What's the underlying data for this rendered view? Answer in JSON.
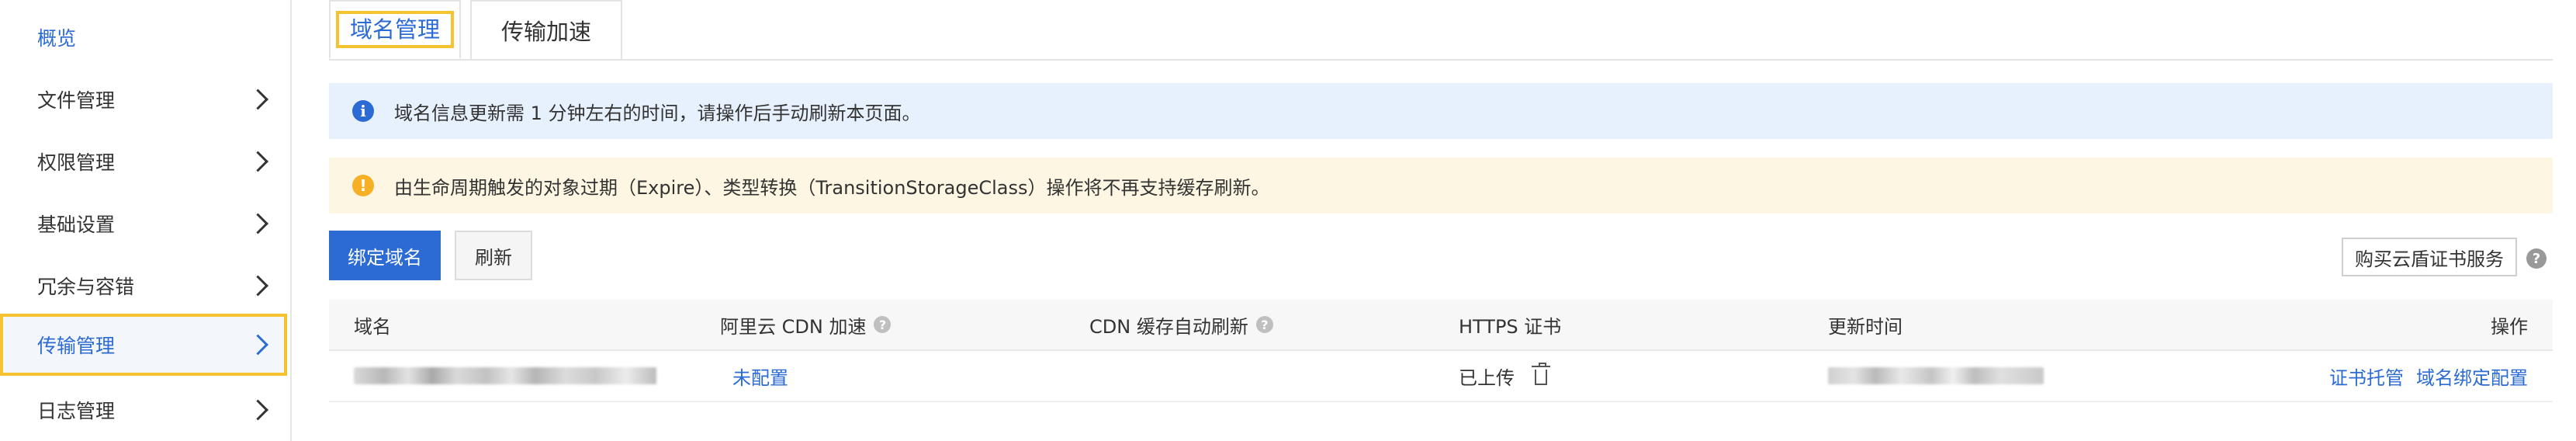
{
  "sidebar": {
    "items": [
      {
        "label": "概览"
      },
      {
        "label": "文件管理"
      },
      {
        "label": "权限管理"
      },
      {
        "label": "基础设置"
      },
      {
        "label": "冗余与容错"
      },
      {
        "label": "传输管理"
      },
      {
        "label": "日志管理"
      }
    ],
    "active": "传输管理"
  },
  "tabs": [
    {
      "label": "域名管理",
      "selected": true
    },
    {
      "label": "传输加速",
      "selected": false
    }
  ],
  "banners": {
    "info": {
      "text": "域名信息更新需 1 分钟左右的时间，请操作后手动刷新本页面。",
      "icon": "info-icon"
    },
    "warning": {
      "text": "由生命周期触发的对象过期（Expire）、类型转换（TransitionStorageClass）操作将不再支持缓存刷新。",
      "icon": "warning-icon"
    }
  },
  "toolbar": {
    "bind_domain": "绑定域名",
    "refresh": "刷新",
    "buy_cert": "购买云盾证书服务"
  },
  "table": {
    "columns": [
      "域名",
      "阿里云 CDN 加速",
      "CDN 缓存自动刷新",
      "HTTPS 证书",
      "更新时间",
      "操作"
    ],
    "rows": [
      {
        "cdn": "未配置",
        "https": "已上传",
        "actions": [
          "证书托管",
          "域名绑定配置"
        ]
      }
    ]
  },
  "colors": {
    "accent": "#2c6bd4",
    "highlight": "#f4c430",
    "info_bg": "#e7f1fd",
    "warn_bg": "#fdf6e2"
  }
}
